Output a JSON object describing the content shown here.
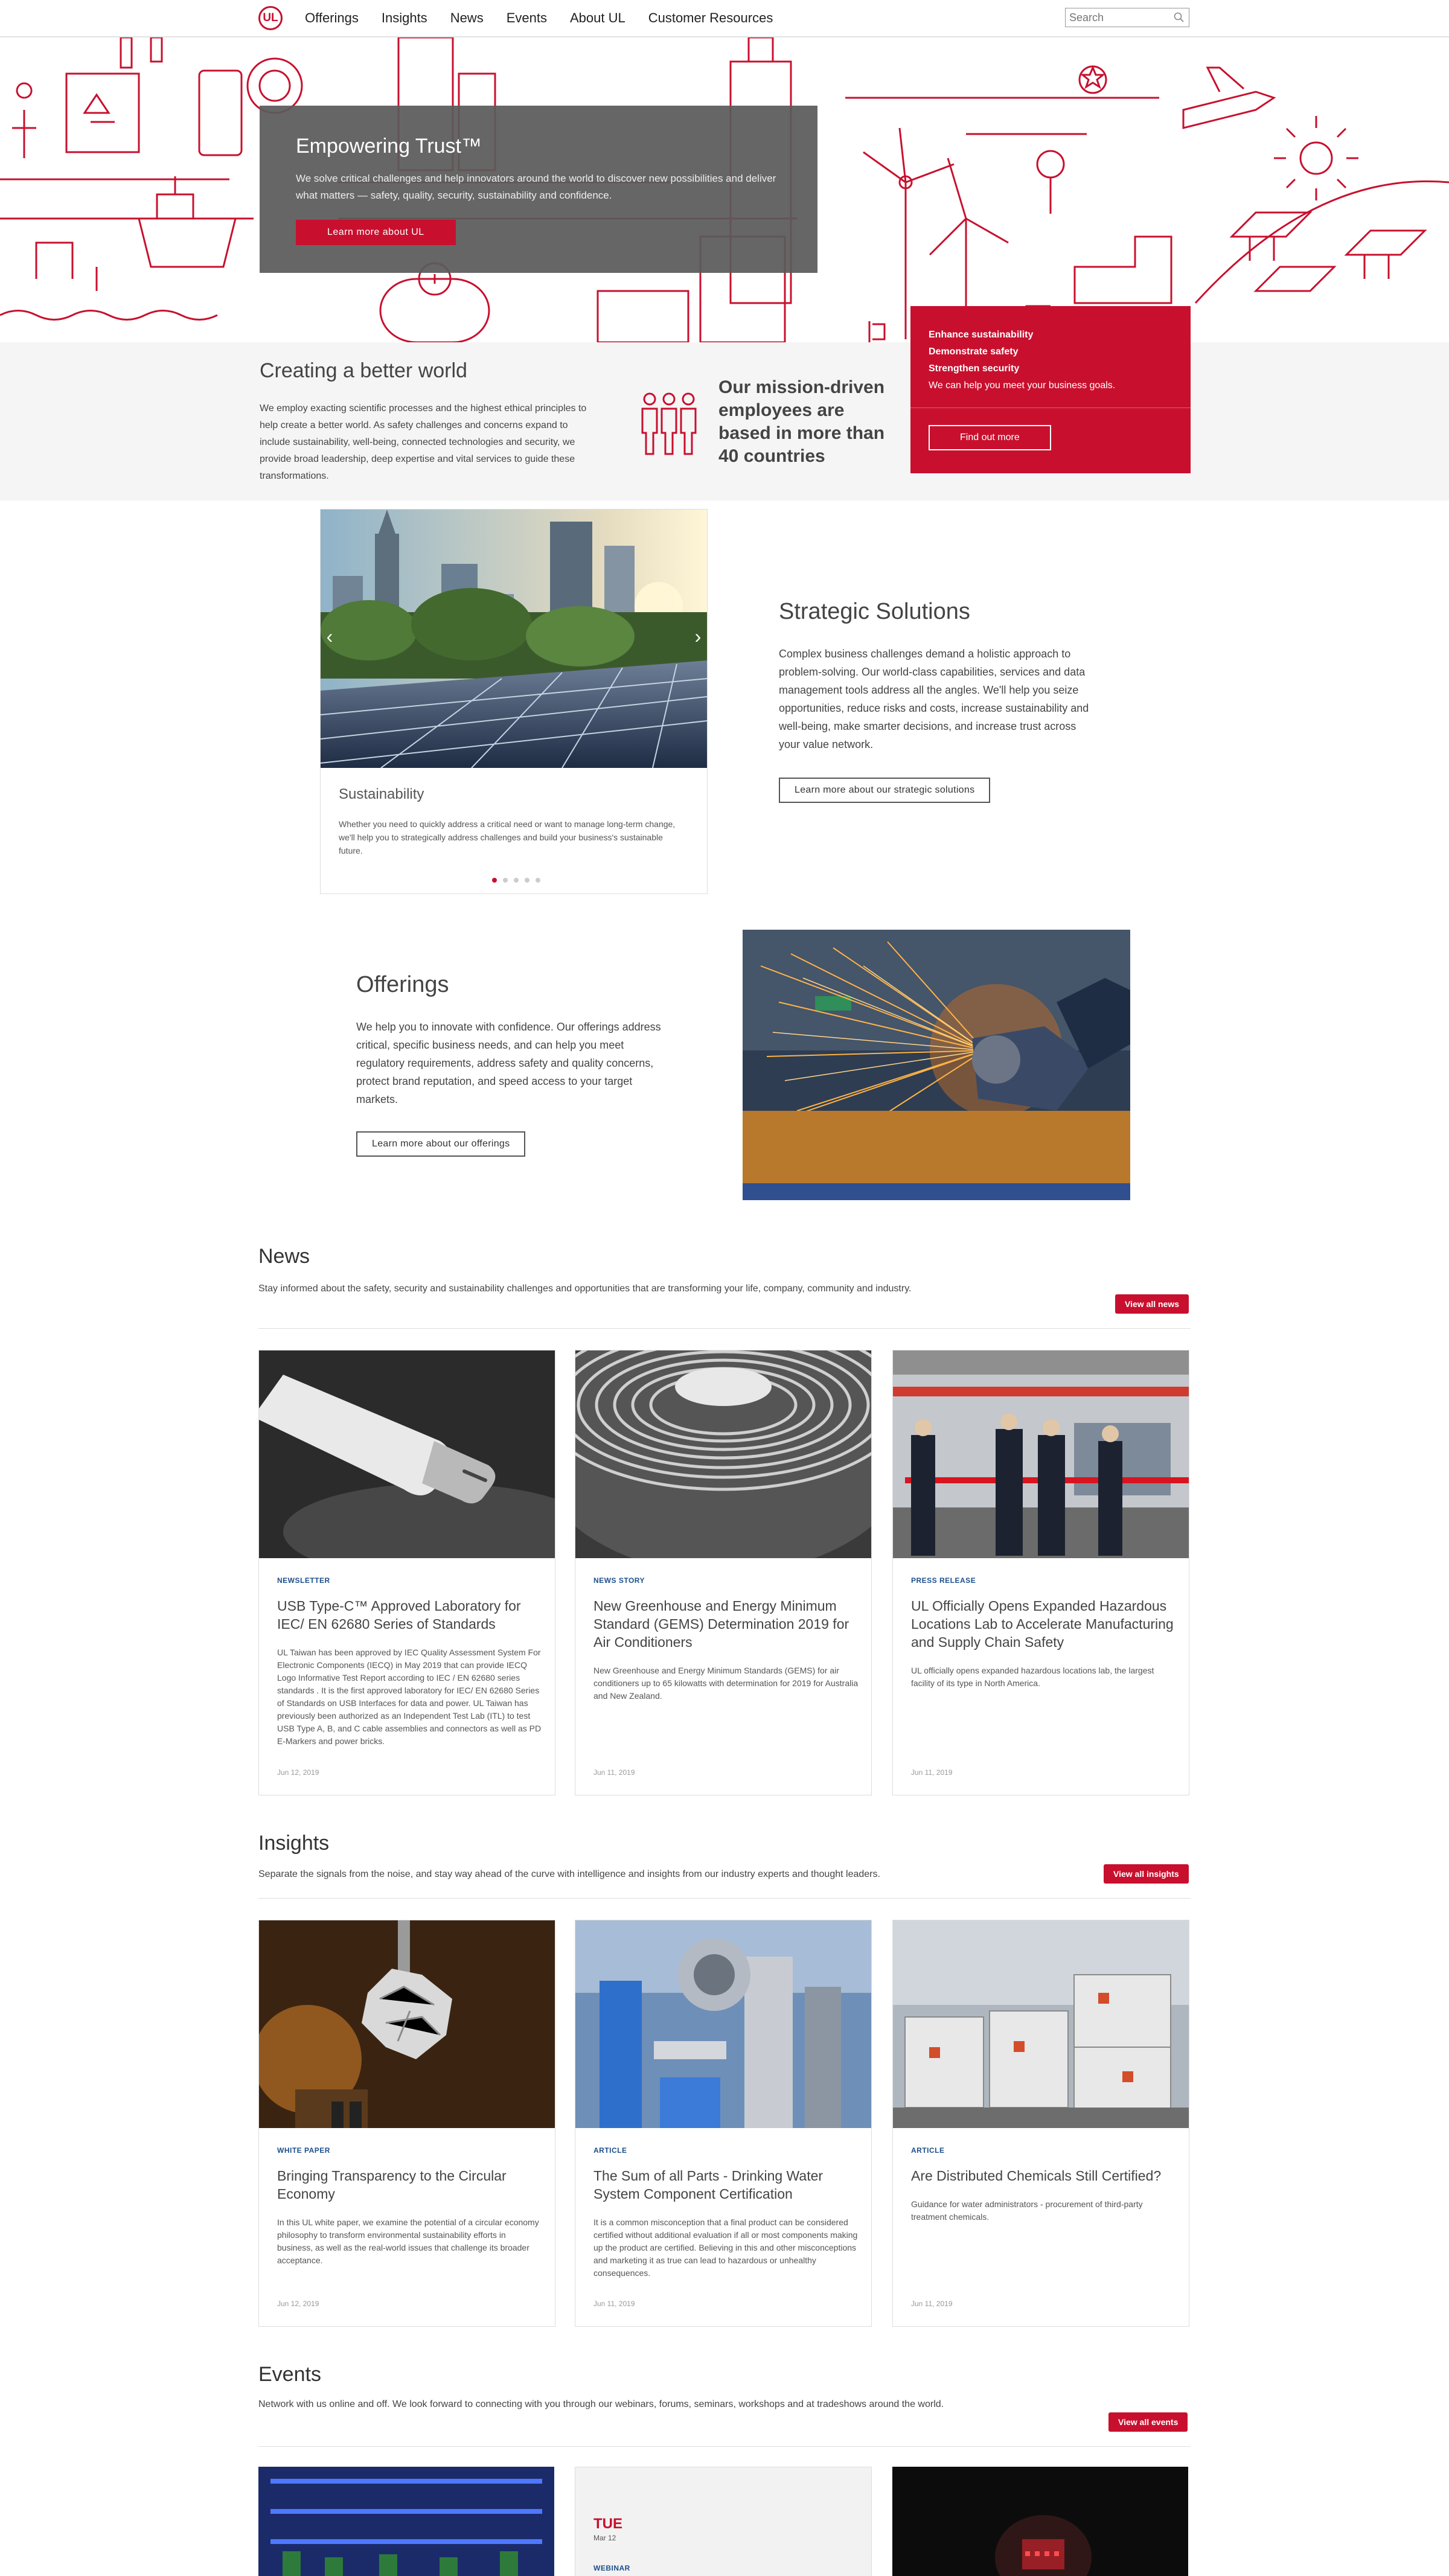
{
  "header": {
    "logo": "UL",
    "nav": [
      "Offerings",
      "Insights",
      "News",
      "Events",
      "About UL",
      "Customer Resources"
    ],
    "search_placeholder": "Search"
  },
  "hero": {
    "title": "Empowering Trust™",
    "text": "We solve critical challenges and help innovators around the world to discover new possibilities and deliver what matters — safety, quality, security, sustainability and confidence.",
    "button": "Learn more about UL",
    "art_color": "#c8102e"
  },
  "creating": {
    "title": "Creating a better world",
    "text": "We employ exacting scientific processes and the highest ethical principles to help create a better world. As safety challenges and concerns expand to include sustainability, well-being, connected technologies and security, we provide broad leadership, deep expertise and vital services to guide these transformations.",
    "mission": "Our mission-driven employees are based in more than 40 countries"
  },
  "promo": {
    "line1": "Enhance sustainability",
    "line2": "Demonstrate safety",
    "line3": "Strengthen security",
    "line4": "We can help you meet your business goals.",
    "button": "Find out more"
  },
  "carousel": {
    "title": "Sustainability",
    "text": "Whether you need to quickly address a critical need or want to manage long-term change, we'll help you to strategically address challenges and build your business's sustainable future.",
    "slides": 5,
    "active": 0
  },
  "strategic": {
    "title": "Strategic Solutions",
    "text": "Complex business challenges demand a holistic approach to problem-solving. Our world-class capabilities, services and data management tools address all the angles. We'll help you seize opportunities, reduce risks and costs, increase sustainability and well-being, make smarter decisions, and increase trust across your value network.",
    "button": "Learn more about our strategic solutions"
  },
  "offerings": {
    "title": "Offerings",
    "text": "We help you to innovate with confidence. Our offerings address critical, specific business needs, and can help you meet regulatory requirements, address safety and quality concerns, protect brand reputation, and speed access to your target markets.",
    "button": "Learn more about our offerings"
  },
  "news": {
    "title": "News",
    "desc": "Stay informed about the safety, security and sustainability challenges and opportunities that are transforming your life, company, community and industry.",
    "button": "View all news",
    "cards": [
      {
        "category": "NEWSLETTER",
        "title": "USB Type-C™ Approved Laboratory for IEC/ EN 62680 Series of Standards",
        "text": "UL Taiwan has been approved by IEC Quality Assessment System For Electronic Components (IECQ) in May 2019 that can provide IECQ Logo Informative Test Report according to IEC / EN 62680 series standards . It is the first approved laboratory for IEC/ EN 62680 Series of Standards on USB Interfaces for data and power. UL Taiwan has previously been authorized as an Independent Test Lab (ITL) to test USB Type A, B, and C cable assemblies and connectors as well as PD E-Markers and power bricks.",
        "date": "Jun 12, 2019"
      },
      {
        "category": "NEWS STORY",
        "title": "New Greenhouse and Energy Minimum Standard (GEMS) Determination 2019 for Air Conditioners",
        "text": "New Greenhouse and Energy Minimum Standards (GEMS) for air conditioners up to 65 kilowatts with determination for 2019 for Australia and New Zealand.",
        "date": "Jun 11, 2019"
      },
      {
        "category": "PRESS RELEASE",
        "title": "UL Officially Opens Expanded Hazardous Locations Lab to Accelerate Manufacturing and Supply Chain Safety",
        "text": "UL officially opens expanded hazardous locations lab, the largest facility of its type in North America.",
        "date": "Jun 11, 2019"
      }
    ]
  },
  "insights": {
    "title": "Insights",
    "desc": "Separate the signals from the noise, and stay way ahead of the curve with intelligence and insights from our industry experts and thought leaders.",
    "button": "View all insights",
    "cards": [
      {
        "category": "WHITE PAPER",
        "title": "Bringing Transparency to the Circular Economy",
        "text": "In this UL white paper, we examine the potential of a circular economy philosophy to transform environmental sustainability efforts in business, as well as the real-world issues that challenge its broader acceptance.",
        "date": "Jun 12, 2019"
      },
      {
        "category": "ARTICLE",
        "title": "The Sum of all Parts - Drinking Water System Component Certification",
        "text": "It is a common misconception that a final product can be considered certified without additional evaluation if all or most components making up the product are certified. Believing in this and other misconceptions and marketing it as true can lead to hazardous or unhealthy consequences.",
        "date": "Jun 11, 2019"
      },
      {
        "category": "ARTICLE",
        "title": "Are Distributed Chemicals Still Certified?",
        "text": "Guidance for water administrators - procurement of third-party treatment chemicals.",
        "date": "Jun 11, 2019"
      }
    ]
  },
  "events": {
    "title": "Events",
    "desc": "Network with us online and off. We look forward to connecting with you through our webinars, forums, seminars, workshops and at tradeshows around the world.",
    "button": "View all events",
    "day": "TUE",
    "date": "Mar 12",
    "category": "WEBINAR"
  }
}
